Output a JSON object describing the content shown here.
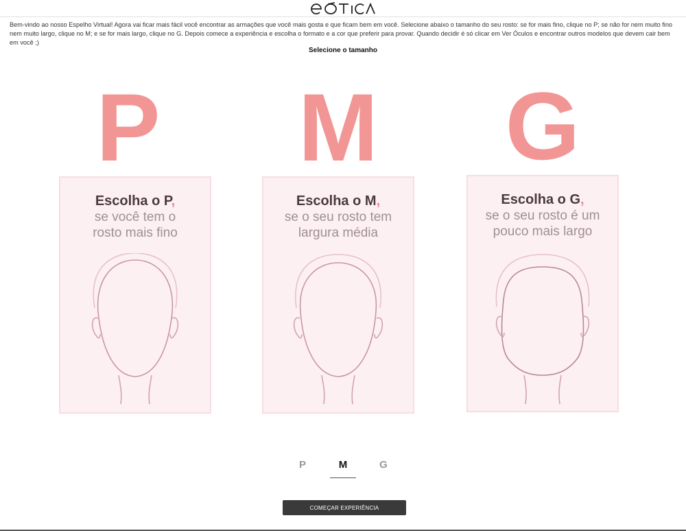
{
  "header": {
    "logo_text": "eótica"
  },
  "intro_text": "Bem-vindo ao nosso Espelho Virtual! Agora vai ficar mais fácil você encontrar as armações que você mais gosta e que ficam bem em você. Selecione abaixo o tamanho do seu rosto: se for mais fino, clique no P; se não for nem muito fino nem muito largo, clique no M; e se for mais largo, clique no G. Depois comece a experiência e escolha o formato e a cor que preferir para provar. Quando decidir é só clicar em Ver Óculos e encontrar outros modelos que devem cair bem em você ;)",
  "subtitle": "Selecione o tamanho",
  "sizes": [
    {
      "letter": "P",
      "title": "Escolha o P",
      "comma": ",",
      "desc1": "se você tem o",
      "desc2": "rosto mais fino"
    },
    {
      "letter": "M",
      "title": "Escolha o M",
      "comma": ",",
      "desc1": "se o seu rosto tem",
      "desc2": "largura média"
    },
    {
      "letter": "G",
      "title": "Escolha o G",
      "comma": ",",
      "desc1": "se o seu rosto é um",
      "desc2": "pouco mais largo"
    }
  ],
  "selector": {
    "options": [
      "P",
      "M",
      "G"
    ],
    "selected": "M"
  },
  "start_button": "COMEÇAR EXPERIÊNCIA",
  "colors": {
    "letter": "#f29695",
    "card_bg": "#fdf0f2",
    "card_border": "#f7dde3",
    "title": "#4a3a3e",
    "desc": "#a08f93",
    "button": "#3a3a3a"
  }
}
